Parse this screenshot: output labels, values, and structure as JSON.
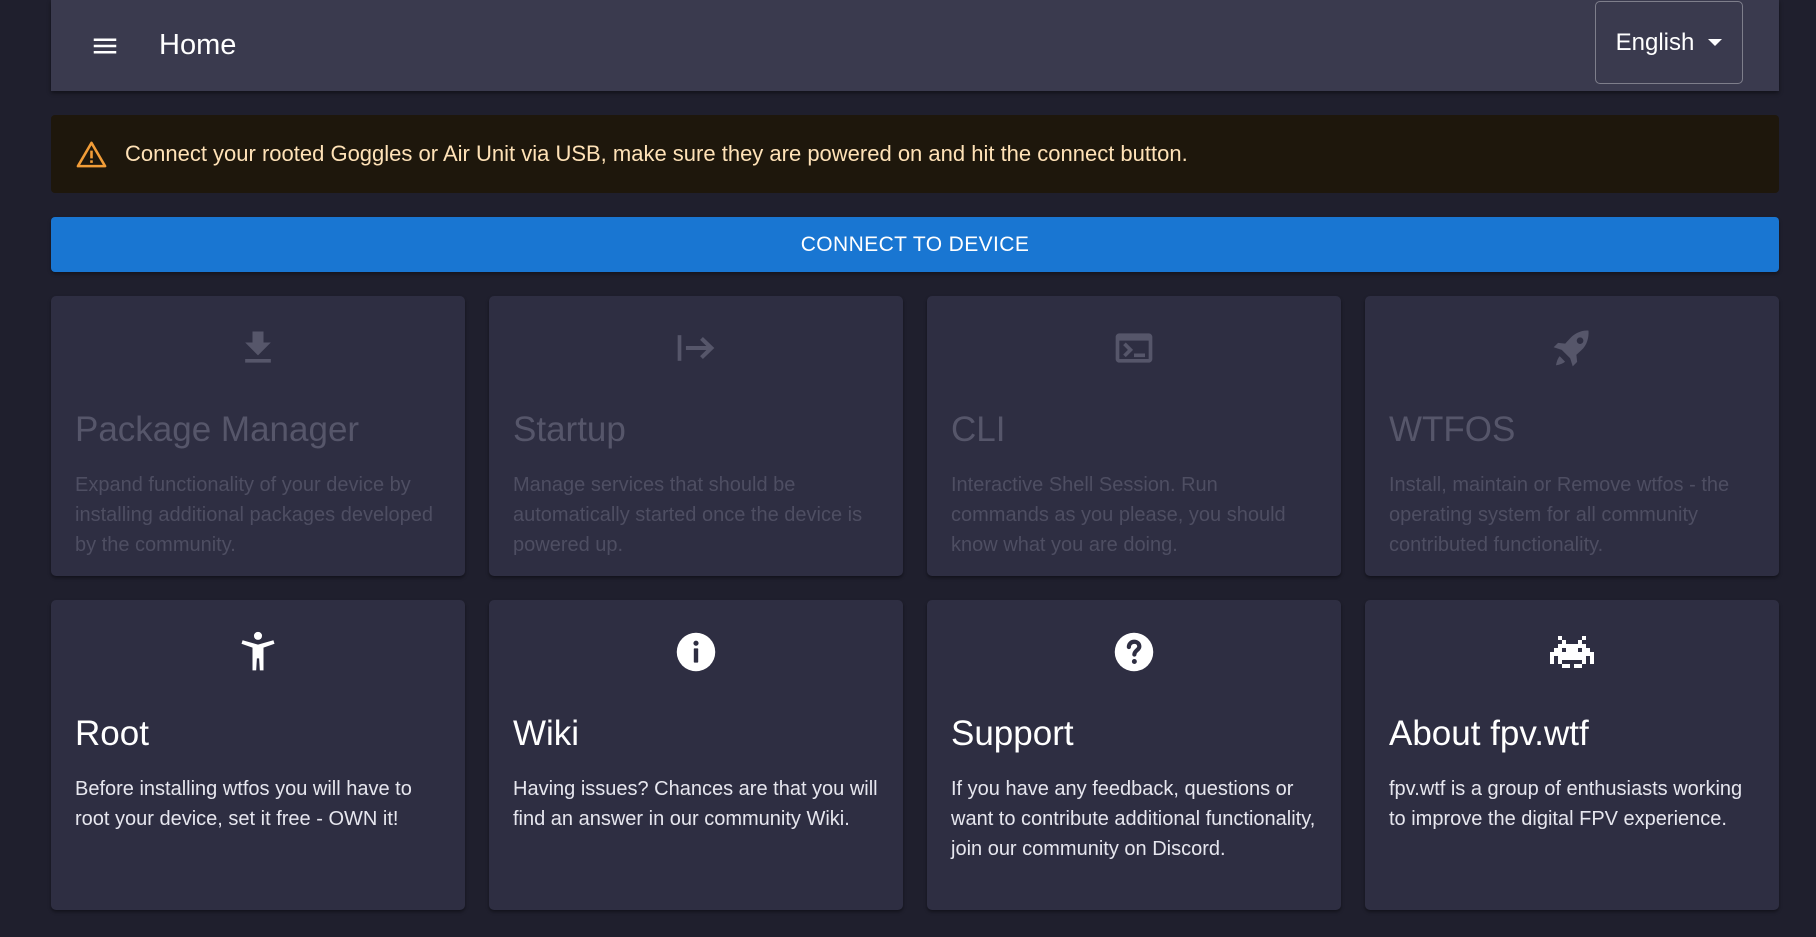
{
  "appbar": {
    "title": "Home",
    "language": "English"
  },
  "alert": {
    "text": "Connect your rooted Goggles or Air Unit via USB, make sure they are powered on and hit the connect button."
  },
  "connect_button": {
    "label": "CONNECT TO DEVICE"
  },
  "cards": [
    {
      "icon": "download-icon",
      "title": "Package Manager",
      "description": "Expand functionality of your device by installing additional packages developed by the community.",
      "disabled": true
    },
    {
      "icon": "arrow-to-bar-icon",
      "title": "Startup",
      "description": "Manage services that should be automatically started once the device is powered up.",
      "disabled": true
    },
    {
      "icon": "terminal-icon",
      "title": "CLI",
      "description": "Interactive Shell Session. Run commands as you please, you should know what you are doing.",
      "disabled": true
    },
    {
      "icon": "rocket-icon",
      "title": "WTFOS",
      "description": "Install, maintain or Remove wtfos - the operating system for all community contributed functionality.",
      "disabled": true
    },
    {
      "icon": "accessibility-icon",
      "title": "Root",
      "description": "Before installing wtfos you will have to root your device, set it free - OWN it!",
      "disabled": false
    },
    {
      "icon": "info-icon",
      "title": "Wiki",
      "description": "Having issues? Chances are that you will find an answer in our community Wiki.",
      "disabled": false
    },
    {
      "icon": "help-icon",
      "title": "Support",
      "description": "If you have any feedback, questions or want to contribute additional functionality, join our community on Discord.",
      "disabled": false
    },
    {
      "icon": "space-invader-icon",
      "title": "About fpv.wtf",
      "description": "fpv.wtf is a group of enthusiasts working to improve the digital FPV experience.",
      "disabled": false
    }
  ],
  "colors": {
    "background": "#1f1f2d",
    "appbar": "#3a3a4e",
    "card": "#2e2e42",
    "primary": "#1976d2",
    "alert_bg": "#1e170c",
    "alert_text": "#ffe2b7",
    "warning_icon": "#f29d38"
  }
}
